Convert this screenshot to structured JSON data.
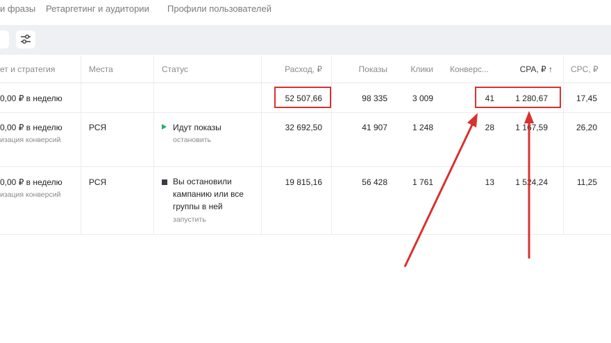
{
  "tabs": [
    "и фразы",
    "Ретаргетинг и аудитории",
    "Профили пользователей"
  ],
  "columns": {
    "budget": "ет и стратегия",
    "places": "Места",
    "status": "Статус",
    "spend": "Расход, ₽",
    "impressions": "Показы",
    "clicks": "Клики",
    "conversions": "Конверс...",
    "cpa": "CPA, ₽ ↑",
    "cpc": "CPC, ₽"
  },
  "rows": [
    {
      "budget": "0,00 ₽ в неделю",
      "budget_sub": "",
      "places": "",
      "status": "",
      "status_action": "",
      "spend": "52 507,66",
      "impressions": "98 335",
      "clicks": "3 009",
      "conversions": "41",
      "cpa": "1 280,67",
      "cpc": "17,45"
    },
    {
      "budget": "0,00 ₽ в неделю",
      "budget_sub": "изация конверсий",
      "places": "РСЯ",
      "status": "Идут показы",
      "status_action": "остановить",
      "spend": "32 692,50",
      "impressions": "41 907",
      "clicks": "1 248",
      "conversions": "28",
      "cpa": "1 167,59",
      "cpc": "26,20"
    },
    {
      "budget": "0,00 ₽ в неделю",
      "budget_sub": "изация конверсий",
      "places": "РСЯ",
      "status": "Вы остановили кампанию или все группы в ней",
      "status_action": "запустить",
      "spend": "19 815,16",
      "impressions": "56 428",
      "clicks": "1 761",
      "conversions": "13",
      "cpa": "1 524,24",
      "cpc": "11,25"
    }
  ],
  "colors": {
    "highlight": "#d9312e",
    "status_active": "#2aa96b",
    "status_stopped": "#3a3a44"
  }
}
